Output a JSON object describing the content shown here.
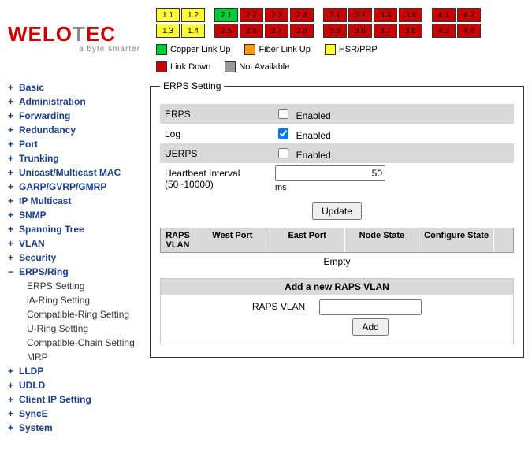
{
  "logo": {
    "brand_pre": "WELO",
    "brand_t": "T",
    "brand_post": "EC",
    "tagline": "a byte smarter"
  },
  "ports": {
    "group1": [
      [
        "1.1",
        "1.2"
      ],
      [
        "1.3",
        "1.4"
      ]
    ],
    "group2": [
      [
        "2.1",
        "2.2",
        "2.3",
        "2.4"
      ],
      [
        "2.5",
        "2.6",
        "2.7",
        "2.8"
      ]
    ],
    "group3": [
      [
        "3.1",
        "3.2",
        "3.3",
        "3.4"
      ],
      [
        "3.5",
        "3.6",
        "3.7",
        "3.8"
      ]
    ],
    "group4": [
      [
        "4.1",
        "4.2"
      ],
      [
        "4.3",
        "4.4"
      ]
    ]
  },
  "legend": {
    "copper_up": "Copper Link Up",
    "fiber_up": "Fiber Link Up",
    "hsr": "HSR/PRP",
    "link_down": "Link Down",
    "na": "Not Available"
  },
  "nav": {
    "basic": "Basic",
    "admin": "Administration",
    "forwarding": "Forwarding",
    "redundancy": "Redundancy",
    "port": "Port",
    "trunking": "Trunking",
    "umac": "Unicast/Multicast MAC",
    "garp": "GARP/GVRP/GMRP",
    "ipmc": "IP Multicast",
    "snmp": "SNMP",
    "stp": "Spanning Tree",
    "vlan": "VLAN",
    "security": "Security",
    "erps": "ERPS/Ring",
    "lldp": "LLDP",
    "udld": "UDLD",
    "clientip": "Client IP Setting",
    "synce": "SyncE",
    "system": "System",
    "sub": {
      "erps_setting": "ERPS Setting",
      "ia": "iA-Ring Setting",
      "compat_ring": "Compatible-Ring Setting",
      "uring": "U-Ring Setting",
      "compat_chain": "Compatible-Chain Setting",
      "mrp": "MRP"
    }
  },
  "panel": {
    "legend": "ERPS Setting",
    "rows": {
      "erps": "ERPS",
      "log": "Log",
      "uerps": "UERPS",
      "enabled": "Enabled",
      "hb_label": "Heartbeat Interval (50~10000)",
      "hb_value": "50",
      "hb_unit": "ms"
    },
    "checks": {
      "erps": false,
      "log": true,
      "uerps": false
    },
    "update": "Update",
    "raps_head": {
      "vlan": "RAPS VLAN",
      "west": "West Port",
      "east": "East Port",
      "node": "Node State",
      "conf": "Configure State"
    },
    "raps_empty": "Empty",
    "add": {
      "title": "Add a new RAPS VLAN",
      "label": "RAPS VLAN",
      "btn": "Add",
      "value": ""
    }
  }
}
